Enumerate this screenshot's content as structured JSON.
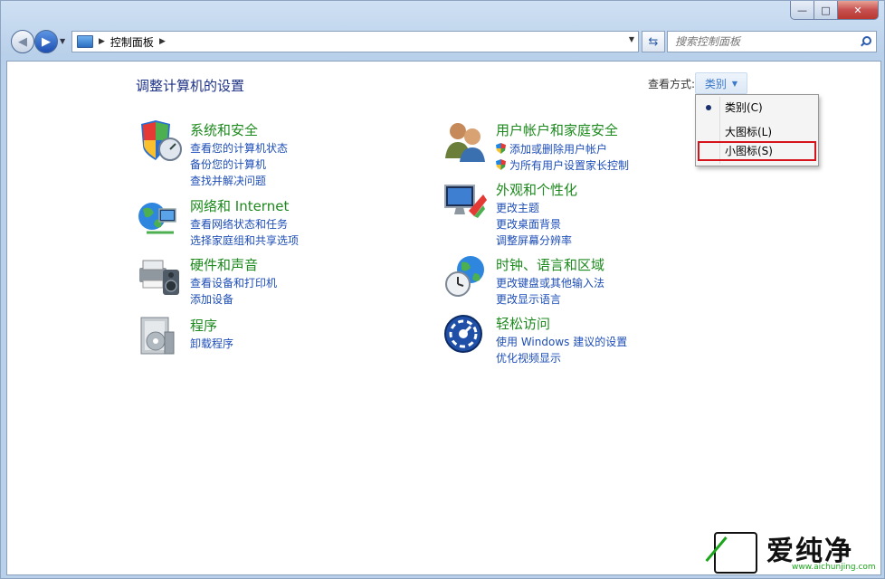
{
  "window": {
    "min_label": "—",
    "max_label": "□",
    "close_label": "✕"
  },
  "address": {
    "crumb": "控制面板",
    "sep": "▶",
    "drop": "▼"
  },
  "search": {
    "placeholder": "搜索控制面板"
  },
  "page": {
    "title": "调整计算机的设置",
    "view_by_label": "查看方式:",
    "view_by_value": "类别"
  },
  "categories": [
    {
      "title": "系统和安全",
      "icon": "system-security-icon",
      "links": [
        "查看您的计算机状态",
        "备份您的计算机",
        "查找并解决问题"
      ]
    },
    {
      "title": "网络和 Internet",
      "icon": "network-internet-icon",
      "links": [
        "查看网络状态和任务",
        "选择家庭组和共享选项"
      ]
    },
    {
      "title": "硬件和声音",
      "icon": "hardware-sound-icon",
      "links": [
        "查看设备和打印机",
        "添加设备"
      ]
    },
    {
      "title": "程序",
      "icon": "programs-icon",
      "links": [
        "卸载程序"
      ]
    },
    {
      "title": "用户帐户和家庭安全",
      "icon": "user-accounts-icon",
      "links": [
        "添加或删除用户帐户",
        "为所有用户设置家长控制"
      ]
    },
    {
      "title": "外观和个性化",
      "icon": "appearance-icon",
      "links": [
        "更改主题",
        "更改桌面背景",
        "调整屏幕分辨率"
      ]
    },
    {
      "title": "时钟、语言和区域",
      "icon": "clock-language-icon",
      "links": [
        "更改键盘或其他输入法",
        "更改显示语言"
      ]
    },
    {
      "title": "轻松访问",
      "icon": "ease-of-access-icon",
      "links": [
        "使用 Windows 建议的设置",
        "优化视频显示"
      ]
    }
  ],
  "menu": {
    "items": [
      "类别(C)",
      "大图标(L)",
      "小图标(S)"
    ],
    "selected_index": 0,
    "highlighted_index": 2
  },
  "watermark": {
    "name": "爱纯净",
    "url": "www.aichunjing.com"
  }
}
